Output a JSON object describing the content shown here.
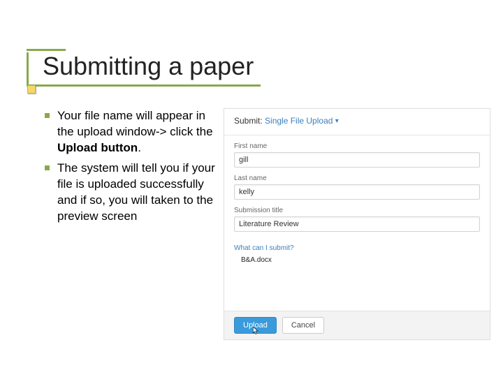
{
  "title": "Submitting a paper",
  "bullets": [
    {
      "pre": "Your file name will appear in the upload window-> click the ",
      "bold": "Upload button",
      "post": "."
    },
    {
      "pre": "The system will tell you if your file is uploaded successfully and if so, you will taken to the preview screen",
      "bold": "",
      "post": ""
    }
  ],
  "panel": {
    "submit_label": "Submit:",
    "submit_mode": "Single File Upload",
    "firstname_label": "First name",
    "firstname_value": "gill",
    "lastname_label": "Last name",
    "lastname_value": "kelly",
    "subtitle_label": "Submission title",
    "subtitle_value": "Literature Review",
    "help_link": "What can I submit?",
    "file_name": "B&A.docx",
    "upload_btn": "Upload",
    "cancel_btn": "Cancel"
  }
}
